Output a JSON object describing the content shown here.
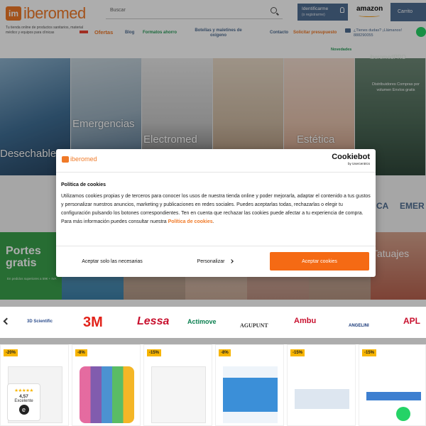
{
  "header": {
    "logo_text": "iberomed",
    "logo_mark": "im",
    "tagline": "Tu tienda online de productos sanitarios, material médico y equipos para clínicas",
    "search_placeholder": "Buscar",
    "login_label": "Identificarme",
    "login_sub": "(o registrarme)",
    "amazon_label": "amazon",
    "cart_label": "Carrito",
    "nav": {
      "ofertas": "Ofertas",
      "blog": "Blog",
      "formatos": "Formatos ahorro",
      "botellas": "Botellas y maletines de oxígeno",
      "contacto": "Contacto",
      "presupuesto": "Solicitar presupuesto",
      "novedades": "Novedades"
    },
    "phone_text": "¿Tienes dudas? ¡Llámanos! 888290055"
  },
  "categories": [
    {
      "label": "Desechables"
    },
    {
      "label": "Emergencias"
    },
    {
      "label": "Electromed"
    },
    {
      "label": ""
    },
    {
      "label": "Estética"
    },
    {
      "label": ""
    }
  ],
  "pro_box": {
    "entra": "Entra en",
    "logo": "iberomedPRO",
    "text": "Distribuidores Compras por volumen Envíos gratis"
  },
  "strip_text": {
    "right1": "CA",
    "right2": "EMER"
  },
  "banners": {
    "portes_title": "Portes gratis",
    "portes_sub": "En pedidos superiores a 59€ + IVA",
    "tatuajes": "Tatuajes"
  },
  "brands": [
    "3D Scientific",
    "3M",
    "Lessa",
    "Actimove",
    "AGUPUNT",
    "Ambu",
    "ANGELINI",
    "APL"
  ],
  "products": [
    {
      "discount": "-20%"
    },
    {
      "discount": "-8%"
    },
    {
      "discount": "-15%"
    },
    {
      "discount": "-8%"
    },
    {
      "discount": "-15%"
    },
    {
      "discount": "-15%"
    }
  ],
  "rating": {
    "stars": "★★★★★",
    "value": "4,57",
    "label": "Excelente",
    "badge": "e"
  },
  "cookie": {
    "brand": "iberomed",
    "cookiebot": "Cookiebot",
    "cookiebot_sub": "by Usercentrics",
    "title": "Política de cookies",
    "body": "Utilizamos cookies propias y de terceros para conocer los usos de nuestra tienda online y poder mejorarla, adaptar el contenido a tus gustos y personalizar nuestros anuncios, marketing y publicaciones en redes sociales. Puedes aceptarlas todas, rechazarlas o elegir tu configuración pulsando los botones correspondientes. Ten en cuenta que rechazar las cookies puede afectar a tu experiencia de compra. Para más información puedes consultar nuestra ",
    "link": "Política de cookies",
    "link_end": ".",
    "btn_necessary": "Aceptar solo las necesarias",
    "btn_personal": "Personalizar",
    "btn_accept": "Aceptar cookies"
  },
  "colors": {
    "brand_orange": "#f07a28",
    "accept_orange": "#f56a14",
    "nav_blue": "#4f6d93",
    "green": "#3aa14c"
  }
}
